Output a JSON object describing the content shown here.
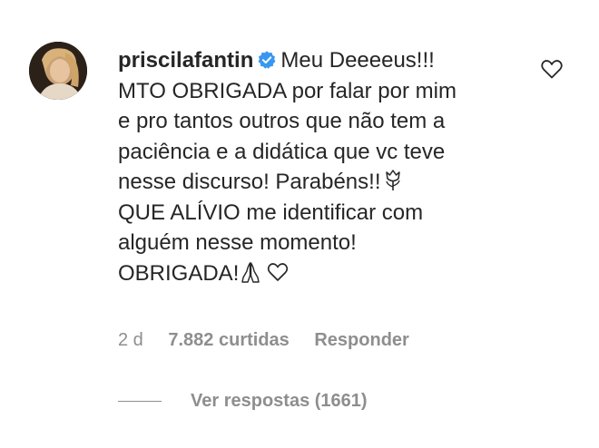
{
  "comment": {
    "username": "priscilafantin",
    "lines": [
      "Meu Deeeeus!!!",
      "MTO OBRIGADA por falar por mim",
      "e pro tantos outros que não tem a",
      "paciência e a didática que vc teve",
      "nesse discurso! Parabéns!!",
      "QUE ALÍVIO me identificar com",
      "alguém nesse momento!",
      "OBRIGADA!"
    ],
    "emojis": [
      "tulip-emoji",
      "praying-hands-emoji",
      "white-heart-emoji"
    ]
  },
  "meta": {
    "age": "2 d",
    "likes": "7.882 curtidas",
    "reply_label": "Responder"
  },
  "replies": {
    "label": "Ver respostas (1661)"
  },
  "icons": {
    "verified": "verified-badge-icon",
    "like": "heart-outline-icon"
  },
  "colors": {
    "text": "#262626",
    "secondary": "#8e8e8e",
    "verified": "#3897f0"
  }
}
